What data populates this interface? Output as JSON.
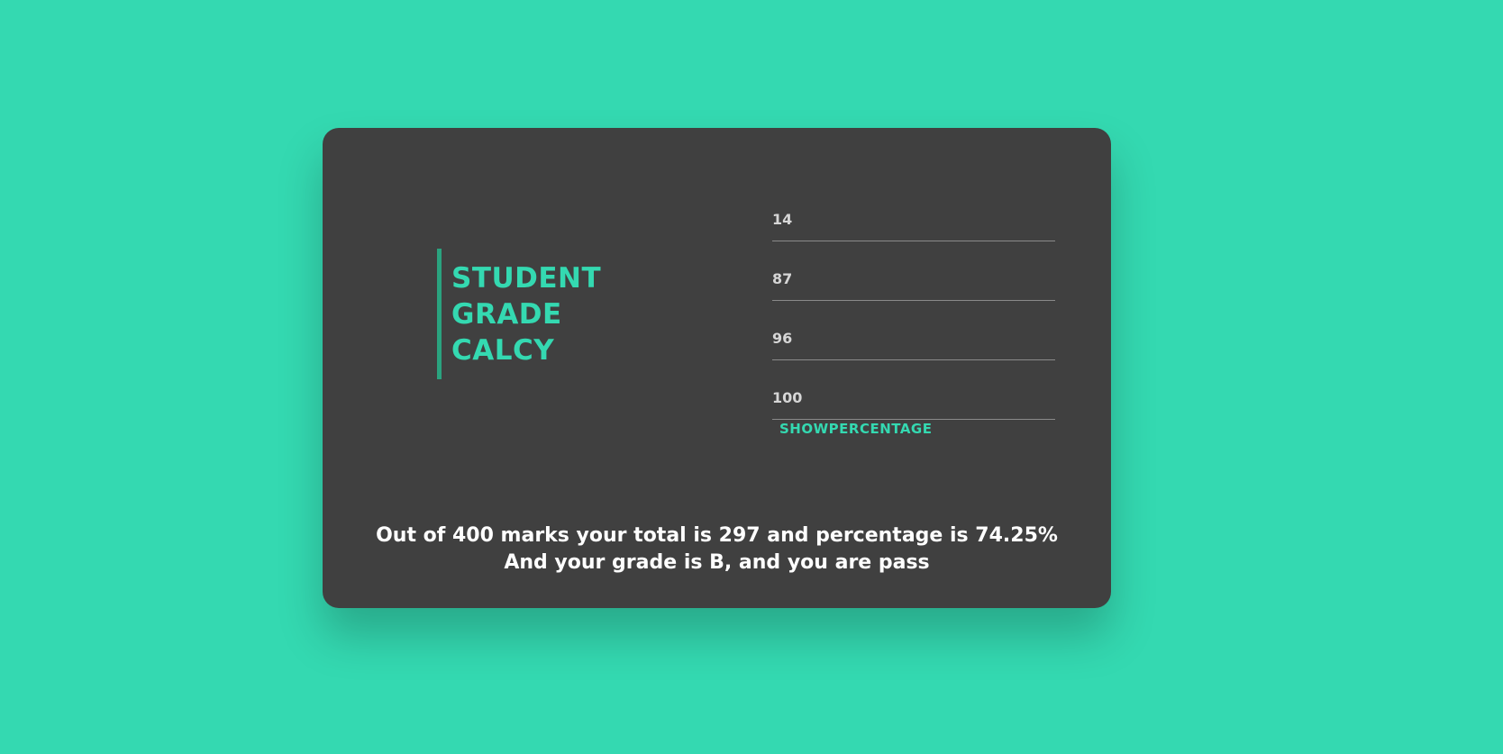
{
  "title": {
    "line1": "STUDENT",
    "line2": "GRADE",
    "line3": "CALCY"
  },
  "inputs": {
    "field1_value": "14",
    "field2_value": "87",
    "field3_value": "96",
    "field4_value": "100"
  },
  "button": {
    "label": "SHOWPERCENTAGE"
  },
  "result": {
    "line1": "Out of 400 marks your total is 297 and percentage is 74.25%",
    "line2": "And your grade is B, and you are pass"
  },
  "colors": {
    "background": "#34d9b1",
    "card": "#404040",
    "accent": "#34d9b1",
    "title_bar": "#2aa37f",
    "result_text": "#ffffff"
  }
}
